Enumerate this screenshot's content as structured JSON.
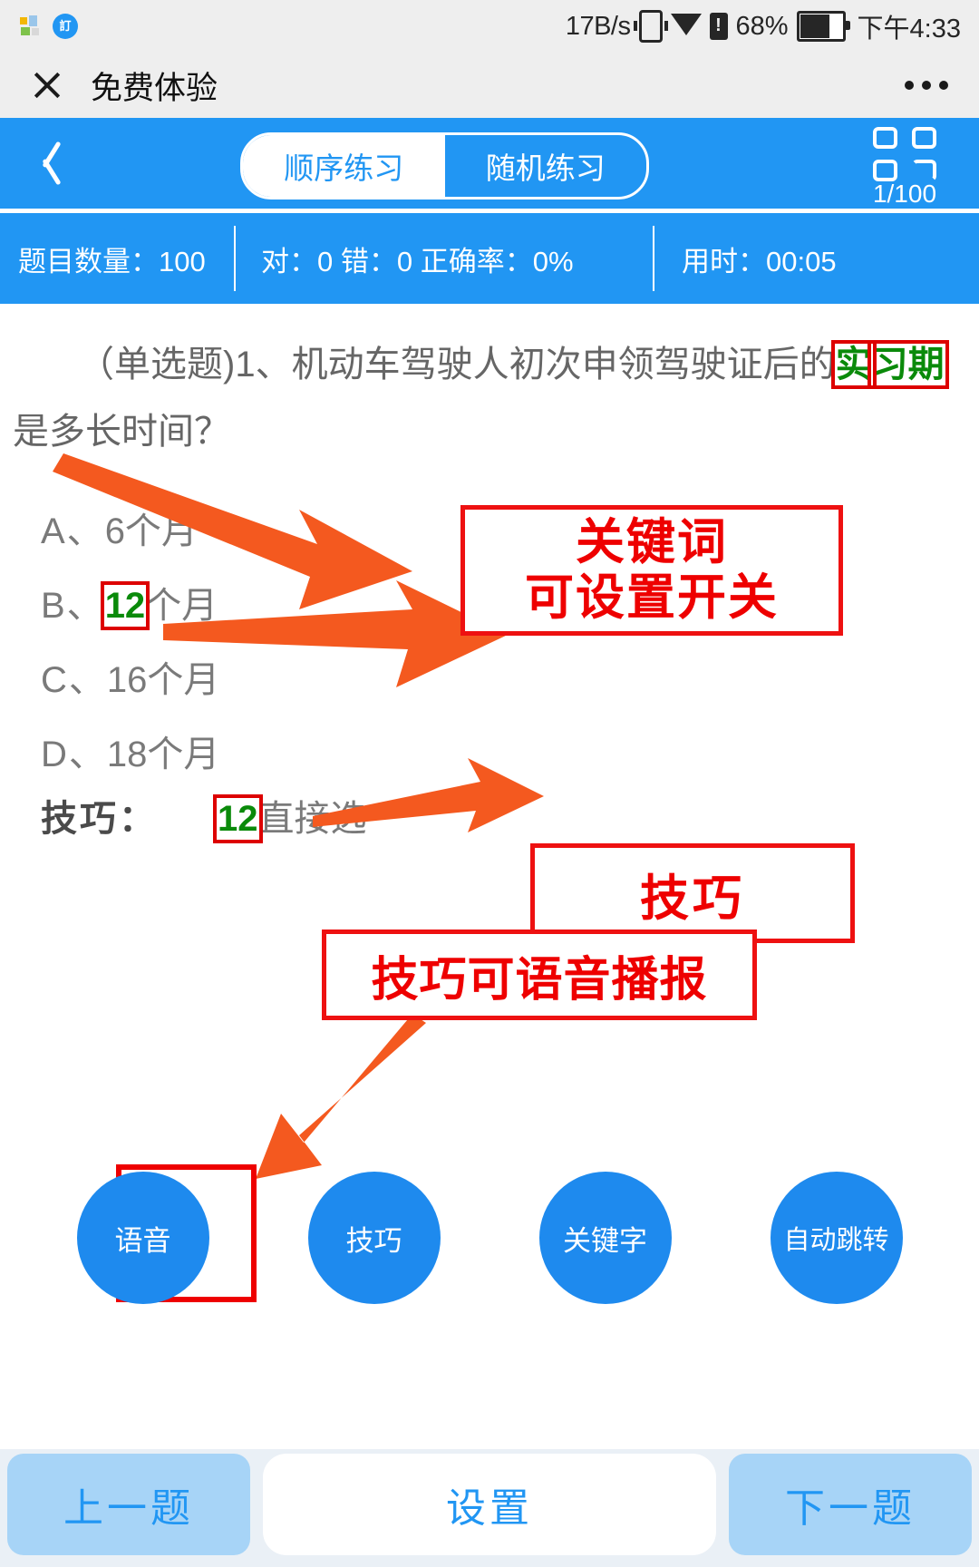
{
  "status_bar": {
    "net_speed": "17B/s",
    "battery_percent": "68%",
    "time": "下午4:33",
    "icons": [
      "app-icon",
      "badge-icon",
      "vibrate-icon",
      "wifi-icon",
      "sim-alert-icon",
      "battery-icon"
    ]
  },
  "title_bar": {
    "close_icon": "close-icon",
    "title": "免费体验",
    "more_icon": "more-icon"
  },
  "app_header": {
    "back_icon": "chevron-left-icon",
    "tabs": [
      {
        "label": "顺序练习",
        "active": true
      },
      {
        "label": "随机练习",
        "active": false
      }
    ],
    "grid_icon": "grid-icon",
    "progress": "1/100"
  },
  "stats": {
    "count": "题目数量：100",
    "score": "对：0 错：0 正确率：0%",
    "time": "用时：00:05"
  },
  "question": {
    "line1_prefix": "（单选题)1、机动车驾驶人初次申领驾驶证后的",
    "line1_keyword": "实",
    "line2_keyword": "习期",
    "line2_suffix": "是多长时间？",
    "options": [
      {
        "label": "A、",
        "text_before": "6个月",
        "highlight": "",
        "text_after": ""
      },
      {
        "label": "B、",
        "text_before": "",
        "highlight": "12",
        "text_after": "个月"
      },
      {
        "label": "C、",
        "text_before": "16个月",
        "highlight": "",
        "text_after": ""
      },
      {
        "label": "D、",
        "text_before": "18个月",
        "highlight": "",
        "text_after": ""
      }
    ],
    "tip_label": "技巧：",
    "tip_highlight": "12",
    "tip_text": "直接选"
  },
  "annotations": {
    "keyword_line1": "关键词",
    "keyword_line2": "可设置开关",
    "skill": "技巧",
    "voice": "技巧可语音播报",
    "accent_red": "#ee0000",
    "accent_orange": "#f4591f",
    "keyword_green": "#0a8a0a"
  },
  "circle_buttons": [
    {
      "label": "语音"
    },
    {
      "label": "技巧"
    },
    {
      "label": "关键字"
    },
    {
      "label": "自动跳转"
    }
  ],
  "bottom_bar": {
    "prev": "上一题",
    "settings": "设置",
    "next": "下一题"
  }
}
